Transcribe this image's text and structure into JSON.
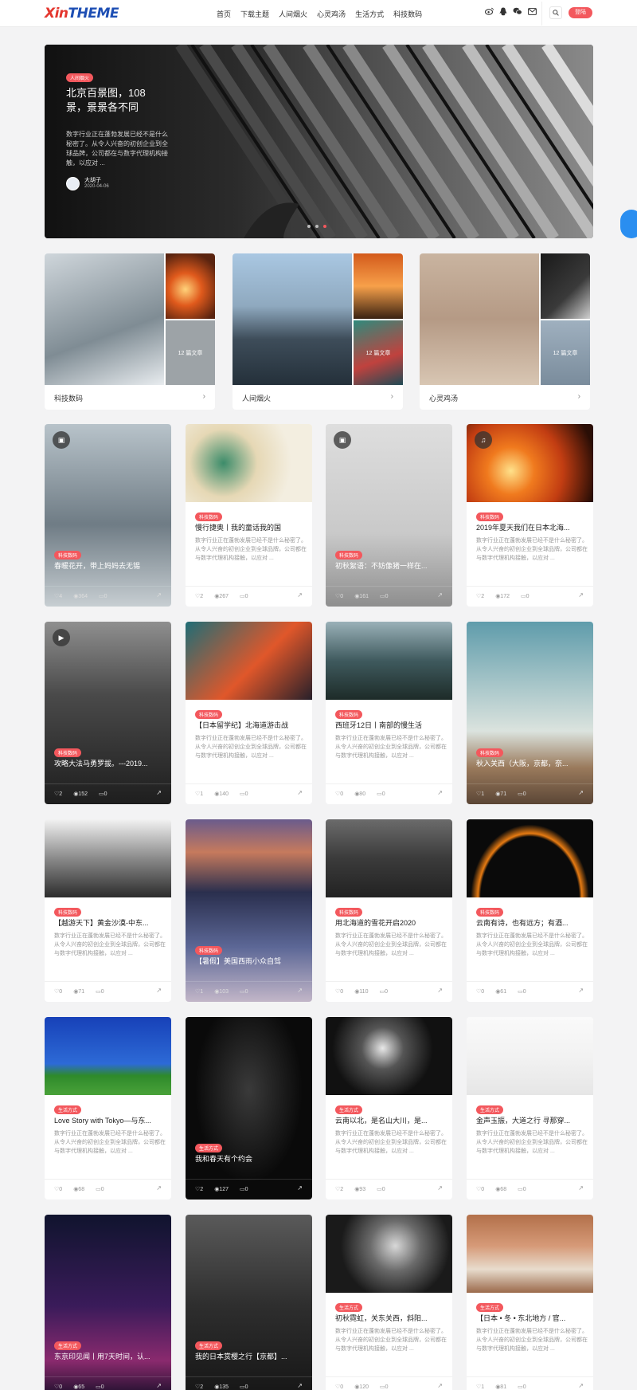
{
  "header": {
    "logo_part1": "Xin",
    "logo_part2": "THEME",
    "nav": [
      "首页",
      "下载主题",
      "人间烟火",
      "心灵鸡汤",
      "生活方式",
      "科技数码"
    ],
    "icons": [
      "weibo-icon",
      "qq-icon",
      "wechat-icon",
      "mail-icon"
    ],
    "login": "登陆",
    "accent": "#f3585d"
  },
  "hero": {
    "tag": "人间烟火",
    "title": "北京百景图，108景，景景各不同",
    "desc": "数字行业正在蓬勃发展已经不是什么秘密了。从令人兴奋的初创企业到全球品牌，公司都在与数字代理机构接触，以应对 ...",
    "author": "大胡子",
    "date": "2020-04-06",
    "slides": 3,
    "active_slide": 3
  },
  "categories": [
    {
      "name": "科技数码",
      "count": "12 篇文章"
    },
    {
      "name": "人间烟火",
      "count": "12 篇文章"
    },
    {
      "name": "心灵鸡汤",
      "count": "12 篇文章"
    }
  ],
  "posts": [
    {
      "tag": "科技数码",
      "title": "春暖花开，带上妈妈去无锡",
      "likes": "4",
      "views": "364",
      "comments": "0",
      "badge": "image"
    },
    {
      "tag": "科技数码",
      "title": "慢行捷奥丨我的童话我的国",
      "desc": "数字行业正在蓬勃发展已经不是什么秘密了。从令人兴奋的初创企业到全球品牌，公司都在与数字代理机构接触，以应对 ...",
      "likes": "2",
      "views": "267",
      "comments": "0"
    },
    {
      "tag": "科技数码",
      "title": "初秋絮语：不妨像猪一样在...",
      "likes": "0",
      "views": "161",
      "comments": "0",
      "badge": "image"
    },
    {
      "tag": "科技数码",
      "title": "2019年夏天我们在日本北海...",
      "desc": "数字行业正在蓬勃发展已经不是什么秘密了。从令人兴奋的初创企业到全球品牌，公司都在与数字代理机构接触，以应对 ...",
      "likes": "2",
      "views": "172",
      "comments": "0",
      "badge": "music"
    },
    {
      "tag": "科技数码",
      "title": "攻略大法马勇罗拔。---2019...",
      "likes": "2",
      "views": "152",
      "comments": "0",
      "badge": "video"
    },
    {
      "tag": "科技数码",
      "title": "【日本留学纪】北海道游击战",
      "desc": "数字行业正在蓬勃发展已经不是什么秘密了。从令人兴奋的初创企业到全球品牌，公司都在与数字代理机构接触，以应对 ...",
      "likes": "1",
      "views": "140",
      "comments": "0"
    },
    {
      "tag": "科技数码",
      "title": "西班牙12日丨南部的慢生活",
      "desc": "数字行业正在蓬勃发展已经不是什么秘密了。从令人兴奋的初创企业到全球品牌，公司都在与数字代理机构接触，以应对 ...",
      "likes": "0",
      "views": "80",
      "comments": "0"
    },
    {
      "tag": "科技数码",
      "title": "秋入关西（大阪，京都，奈...",
      "likes": "1",
      "views": "71",
      "comments": "0"
    },
    {
      "tag": "科技数码",
      "title": "【越游天下】黄金沙漠-中东...",
      "desc": "数字行业正在蓬勃发展已经不是什么秘密了。从令人兴奋的初创企业到全球品牌，公司都在与数字代理机构接触，以应对 ...",
      "likes": "0",
      "views": "71",
      "comments": "0"
    },
    {
      "tag": "科技数码",
      "title": "【暑假】美国西雨小众自驾",
      "likes": "1",
      "views": "103",
      "comments": "0"
    },
    {
      "tag": "科技数码",
      "title": "用北海道的雪花开启2020",
      "desc": "数字行业正在蓬勃发展已经不是什么秘密了。从令人兴奋的初创企业到全球品牌，公司都在与数字代理机构接触，以应对 ...",
      "likes": "0",
      "views": "110",
      "comments": "0"
    },
    {
      "tag": "科技数码",
      "title": "云南有诗，也有远方；有酒...",
      "desc": "数字行业正在蓬勃发展已经不是什么秘密了。从令人兴奋的初创企业到全球品牌，公司都在与数字代理机构接触，以应对 ...",
      "likes": "0",
      "views": "61",
      "comments": "0"
    },
    {
      "tag": "生活方式",
      "title": "Love Story with Tokyo—与东...",
      "desc": "数字行业正在蓬勃发展已经不是什么秘密了。从令人兴奋的初创企业到全球品牌，公司都在与数字代理机构接触，以应对 ...",
      "likes": "0",
      "views": "68",
      "comments": "0"
    },
    {
      "tag": "生活方式",
      "title": "我和春天有个约会",
      "likes": "2",
      "views": "127",
      "comments": "0"
    },
    {
      "tag": "生活方式",
      "title": "云南以北，是名山大川，是...",
      "desc": "数字行业正在蓬勃发展已经不是什么秘密了。从令人兴奋的初创企业到全球品牌，公司都在与数字代理机构接触，以应对 ...",
      "likes": "2",
      "views": "93",
      "comments": "0"
    },
    {
      "tag": "生活方式",
      "title": "金声玉振，大道之行 寻那穿...",
      "desc": "数字行业正在蓬勃发展已经不是什么秘密了。从令人兴奋的初创企业到全球品牌，公司都在与数字代理机构接触，以应对 ...",
      "likes": "0",
      "views": "68",
      "comments": "0"
    },
    {
      "tag": "生活方式",
      "title": "东京印见闻丨用7天时间，认...",
      "likes": "0",
      "views": "65",
      "comments": "0"
    },
    {
      "tag": "生活方式",
      "title": "我的日本赏樱之行【京都】...",
      "likes": "2",
      "views": "135",
      "comments": "0"
    },
    {
      "tag": "生活方式",
      "title": "初秋霓虹，关东关西，斜阳...",
      "desc": "数字行业正在蓬勃发展已经不是什么秘密了。从令人兴奋的初创企业到全球品牌，公司都在与数字代理机构接触，以应对 ...",
      "likes": "0",
      "views": "120",
      "comments": "0"
    },
    {
      "tag": "生活方式",
      "title": "【日本 • 冬 • 东北地方 / 官...",
      "desc": "数字行业正在蓬勃发展已经不是什么秘密了。从令人兴奋的初创企业到全球品牌，公司都在与数字代理机构接触，以应对 ...",
      "likes": "1",
      "views": "81",
      "comments": "0"
    }
  ]
}
